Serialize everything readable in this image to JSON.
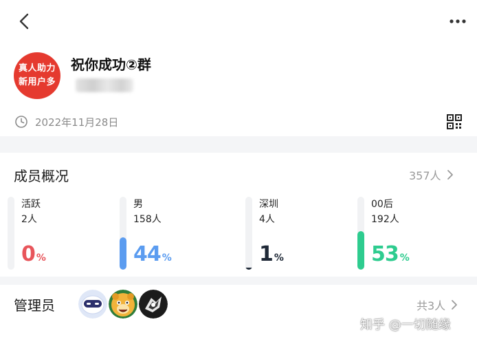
{
  "group": {
    "avatar_line1": "真人助力",
    "avatar_line2": "新用户多",
    "name": "祝你成功②群",
    "created_date": "2022年11月28日"
  },
  "members": {
    "title": "成员概况",
    "total": "357人",
    "stats": [
      {
        "label": "活跃",
        "count": "2人",
        "percent_value": "0",
        "percent_sign": "%",
        "fraction": 0.0,
        "color": "#e8555b"
      },
      {
        "label": "男",
        "count": "158人",
        "percent_value": "44",
        "percent_sign": "%",
        "fraction": 0.44,
        "color": "#5b9cf0"
      },
      {
        "label": "深圳",
        "count": "4人",
        "percent_value": "1",
        "percent_sign": "%",
        "fraction": 0.01,
        "color": "#1f2937"
      },
      {
        "label": "00后",
        "count": "192人",
        "percent_value": "53",
        "percent_sign": "%",
        "fraction": 0.53,
        "color": "#2ecc8f"
      }
    ]
  },
  "admins": {
    "title": "管理员",
    "total": "共3人",
    "avatars": [
      "robot-avatar",
      "cartoon-bear-avatar",
      "dark-avatar"
    ]
  },
  "watermark": "知乎 @一切随缘"
}
